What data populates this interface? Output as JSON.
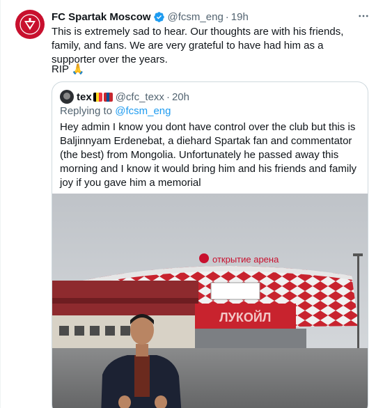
{
  "tweet": {
    "author_name": "FC Spartak Moscow",
    "author_handle": "@fcsm_eng",
    "separator": "·",
    "time": "19h",
    "more_label": "···",
    "text": "This is extremely sad to hear. Our thoughts are with his friends, family, and fans. We are very grateful to have had him as a supporter over the years.",
    "rip_text": "RIP",
    "rip_emoji": "🙏"
  },
  "quote": {
    "author_name": "tex",
    "author_handle": "@cfc_texx",
    "separator": "·",
    "time": "20h",
    "replying_prefix": "Replying to ",
    "replying_handle": "@fcsm_eng",
    "text": "Hey admin I know you dont have control over the club but this is Baljinnyam Erdenebat, a diehard Spartak fan and commentator (the best) from Mongolia. Unfortunately he passed away this morning and I know it would bring him and his friends and family joy if you gave him a memorial"
  },
  "photo": {
    "arena_sign": "открытие арена",
    "banner_text": "ЛУКОЙЛ"
  },
  "colors": {
    "spartak_red": "#c8102e",
    "verified_blue": "#1d9bf0",
    "link_blue": "#1d9bf0",
    "muted_gray": "#536471"
  },
  "icons": {
    "verified": "verified-badge-icon",
    "more": "more-horizontal-icon",
    "logo": "spartak-logo-icon"
  }
}
